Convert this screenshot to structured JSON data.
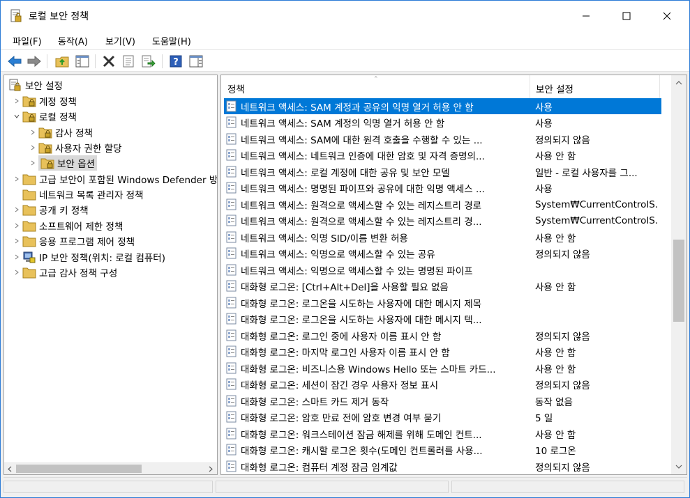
{
  "window": {
    "title": "로컬 보안 정책"
  },
  "menu": [
    {
      "label": "파일(F)"
    },
    {
      "label": "동작(A)"
    },
    {
      "label": "보기(V)"
    },
    {
      "label": "도움말(H)"
    }
  ],
  "toolbar": {
    "icons": [
      "back-arrow-icon",
      "forward-arrow-icon",
      "up-folder-icon",
      "show-hide-tree-icon",
      "delete-icon",
      "properties-icon",
      "export-list-icon",
      "help-icon",
      "action-pane-icon"
    ]
  },
  "tree": {
    "root": "보안 설정",
    "items": [
      {
        "label": "계정 정책"
      },
      {
        "label": "로컬 정책"
      },
      {
        "label": "감사 정책"
      },
      {
        "label": "사용자 권한 할당"
      },
      {
        "label": "보안 옵션"
      },
      {
        "label": "고급 보안이 포함된 Windows Defender 방화벽"
      },
      {
        "label": "네트워크 목록 관리자 정책"
      },
      {
        "label": "공개 키 정책"
      },
      {
        "label": "소프트웨어 제한 정책"
      },
      {
        "label": "응용 프로그램 제어 정책"
      },
      {
        "label": "IP 보안 정책(위치: 로컬 컴퓨터)"
      },
      {
        "label": "고급 감사 정책 구성"
      }
    ]
  },
  "list": {
    "columns": {
      "policy": "정책",
      "setting": "보안 설정"
    },
    "rows": [
      {
        "policy": "네트워크 액세스: SAM 계정과 공유의 익명 열거 허용 안 함",
        "setting": "사용"
      },
      {
        "policy": "네트워크 액세스: SAM 계정의 익명 열거 허용 안 함",
        "setting": "사용"
      },
      {
        "policy": "네트워크 액세스: SAM에 대한 원격 호출을 수행할 수 있는 ...",
        "setting": "정의되지 않음"
      },
      {
        "policy": "네트워크 액세스: 네트워크 인증에 대한 암호 및 자격 증명의...",
        "setting": "사용 안 함"
      },
      {
        "policy": "네트워크 액세스: 로컬 계정에 대한 공유 및 보안 모델",
        "setting": "일반 - 로컬 사용자를 그..."
      },
      {
        "policy": "네트워크 액세스: 명명된 파이프와 공유에 대한 익명 액세스 ...",
        "setting": "사용"
      },
      {
        "policy": "네트워크 액세스: 원격으로 액세스할 수 있는 레지스트리 경로",
        "setting": "System₩CurrentControlS..."
      },
      {
        "policy": "네트워크 액세스: 원격으로 액세스할 수 있는 레지스트리 경...",
        "setting": "System₩CurrentControlS..."
      },
      {
        "policy": "네트워크 액세스: 익명 SID/이름 변환 허용",
        "setting": "사용 안 함"
      },
      {
        "policy": "네트워크 액세스: 익명으로 액세스할 수 있는 공유",
        "setting": "정의되지 않음"
      },
      {
        "policy": "네트워크 액세스: 익명으로 액세스할 수 있는 명명된 파이프",
        "setting": ""
      },
      {
        "policy": "대화형 로그온: [Ctrl+Alt+Del]을 사용할 필요 없음",
        "setting": "사용 안 함"
      },
      {
        "policy": "대화형 로그온: 로그온을 시도하는 사용자에 대한 메시지 제목",
        "setting": ""
      },
      {
        "policy": "대화형 로그온: 로그온을 시도하는 사용자에 대한 메시지 텍...",
        "setting": ""
      },
      {
        "policy": "대화형 로그온: 로그인 중에 사용자 이름 표시 안 함",
        "setting": "정의되지 않음"
      },
      {
        "policy": "대화형 로그온: 마지막 로그인 사용자 이름 표시 안 함",
        "setting": "사용 안 함"
      },
      {
        "policy": "대화형 로그온: 비즈니스용 Windows Hello 또는 스마트 카드...",
        "setting": "사용 안 함"
      },
      {
        "policy": "대화형 로그온: 세션이 잠긴 경우 사용자 정보 표시",
        "setting": "정의되지 않음"
      },
      {
        "policy": "대화형 로그온: 스마트 카드 제거 동작",
        "setting": "동작 없음"
      },
      {
        "policy": "대화형 로그온: 암호 만료 전에 암호 변경 여부 묻기",
        "setting": "5 일"
      },
      {
        "policy": "대화형 로그온: 워크스테이션 잠금 해제를 위해 도메인 컨트...",
        "setting": "사용 안 함"
      },
      {
        "policy": "대화형 로그온: 캐시할 로그온 횟수(도메인 컨트롤러를 사용...",
        "setting": "10 로그온"
      },
      {
        "policy": "대화형 로그온: 컴퓨터 계정 잠금 임계값",
        "setting": "정의되지 않음"
      }
    ]
  },
  "colors": {
    "selection": "#0078d7",
    "folder": "#e8c15a",
    "lock": "#c9a227"
  }
}
